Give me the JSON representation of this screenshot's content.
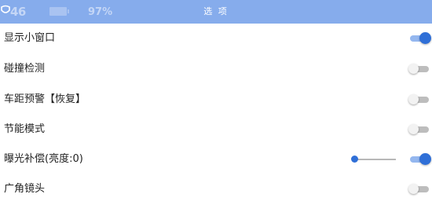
{
  "status_bar": {
    "signal": "46",
    "battery": "97%"
  },
  "header": {
    "title": "选 项"
  },
  "settings": [
    {
      "label": "显示小窗口",
      "enabled": true
    },
    {
      "label": "碰撞检测",
      "enabled": false
    },
    {
      "label": "车距预警【恢复】",
      "enabled": false
    },
    {
      "label": "节能模式",
      "enabled": false
    },
    {
      "label": "曝光补偿(亮度:0)",
      "enabled": true,
      "brightness_slider_value": 0
    },
    {
      "label": "广角镜头",
      "enabled": false
    }
  ],
  "colors": {
    "header_bg": "#86acec",
    "toggle_on": "#2f6fd7",
    "toggle_track_on": "#94b7ef",
    "toggle_off_track": "#bdbdbd"
  }
}
